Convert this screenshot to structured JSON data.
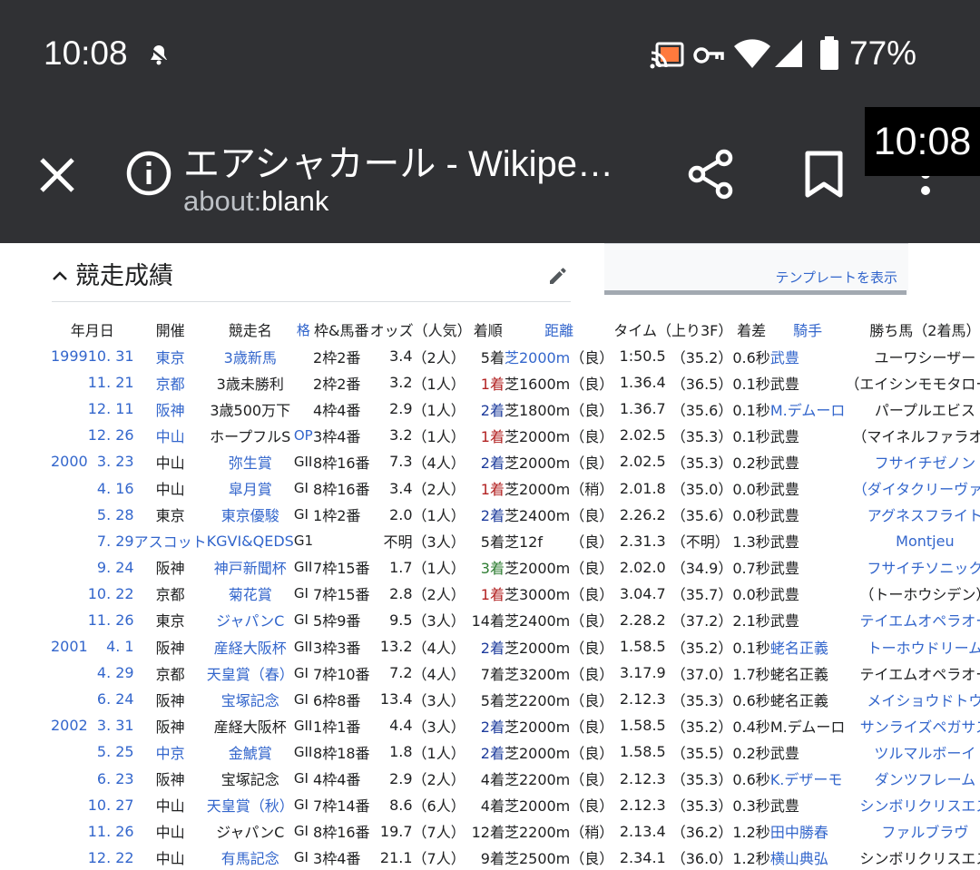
{
  "status_bar": {
    "time": "10:08",
    "battery": "77%",
    "icons": [
      "alert-icon",
      "cast-icon",
      "vpn-key-icon",
      "wifi-icon",
      "signal-icon",
      "battery-icon"
    ]
  },
  "toolbar": {
    "title": "エアシャカール - Wikipe…",
    "url_scheme": "about:",
    "url_host": "blank",
    "clock_overlay": "10:08"
  },
  "infobox": {
    "template_link": "テンプレートを表示"
  },
  "section": {
    "title": "競走成績"
  },
  "colors": {
    "link": "#3366cc",
    "win": "#b22222",
    "second": "#1e3c9c",
    "third": "#2e7d32",
    "toolbar": "#303134"
  },
  "table": {
    "headers": [
      "年月日",
      "開催",
      "競走名",
      "格",
      "枠&馬番",
      "オッズ（人気）",
      "着順",
      "距離",
      "タイム（上り3F）",
      "着差",
      "騎手",
      "勝ち馬（2着馬）"
    ],
    "rows": [
      {
        "yr": "1999",
        "md": "10. 31",
        "ven": "東京",
        "race": "3歳新馬",
        "grade": "",
        "gate": "2枠2番",
        "odds": "3.4",
        "pop": "（2人）",
        "fin": "5着",
        "dist": "芝2000m",
        "cond": "（良）",
        "time": "1:50.5",
        "last": "（35.2）",
        "margin": "0.6秒",
        "jockey": "武豊",
        "winner": "ユーワシーザー"
      },
      {
        "yr": "",
        "md": "11. 21",
        "ven": "京都",
        "race": "3歳未勝利",
        "grade": "",
        "gate": "2枠2番",
        "odds": "3.2",
        "pop": "（1人）",
        "fin": "1着",
        "dist": "芝1600m",
        "cond": "（良）",
        "time": "1.36.4",
        "last": "（36.5）",
        "margin": "0.1秒",
        "jockey": "武豊",
        "winner": "（エイシンモモタロー）"
      },
      {
        "yr": "",
        "md": "12. 11",
        "ven": "阪神",
        "race": "3歳500万下",
        "grade": "",
        "gate": "4枠4番",
        "odds": "2.9",
        "pop": "（1人）",
        "fin": "2着",
        "dist": "芝1800m",
        "cond": "（良）",
        "time": "1.36.7",
        "last": "（35.6）",
        "margin": "0.1秒",
        "jockey": "M.デムーロ",
        "winner": "パープルエビス"
      },
      {
        "yr": "",
        "md": "12. 26",
        "ven": "中山",
        "race": "ホープフルS",
        "grade": "OP",
        "gate": "3枠4番",
        "odds": "3.2",
        "pop": "（1人）",
        "fin": "1着",
        "dist": "芝2000m",
        "cond": "（良）",
        "time": "2.02.5",
        "last": "（35.3）",
        "margin": "0.1秒",
        "jockey": "武豊",
        "winner": "（マイネルファラオ）"
      },
      {
        "yr": "2000",
        "md": "3. 23",
        "ven": "中山",
        "race": "弥生賞",
        "grade": "GII",
        "gate": "8枠16番",
        "odds": "7.3",
        "pop": "（4人）",
        "fin": "2着",
        "dist": "芝2000m",
        "cond": "（良）",
        "time": "2.02.5",
        "last": "（35.3）",
        "margin": "0.2秒",
        "jockey": "武豊",
        "winner": "フサイチゼノン"
      },
      {
        "yr": "",
        "md": "4. 16",
        "ven": "中山",
        "race": "皐月賞",
        "grade": "GI",
        "gate": "8枠16番",
        "odds": "3.4",
        "pop": "（2人）",
        "fin": "1着",
        "dist": "芝2000m",
        "cond": "（稍）",
        "time": "2.01.8",
        "last": "（35.0）",
        "margin": "0.0秒",
        "jockey": "武豊",
        "winner": "（ダイタクリーヴァ）"
      },
      {
        "yr": "",
        "md": "5. 28",
        "ven": "東京",
        "race": "東京優駿",
        "grade": "GI",
        "gate": "1枠2番",
        "odds": "2.0",
        "pop": "（1人）",
        "fin": "2着",
        "dist": "芝2400m",
        "cond": "（良）",
        "time": "2.26.2",
        "last": "（35.6）",
        "margin": "0.0秒",
        "jockey": "武豊",
        "winner": "アグネスフライト"
      },
      {
        "yr": "",
        "md": "7. 29",
        "ven": "アスコット",
        "race": "KGVI&QEDS",
        "grade": "G1",
        "gate": "",
        "odds": "不明",
        "pop": "（3人）",
        "fin": "5着",
        "dist": "芝12f",
        "cond": "（良）",
        "time": "2.31.3",
        "last": "（不明）",
        "margin": "1.3秒",
        "jockey": "武豊",
        "winner": "Montjeu"
      },
      {
        "yr": "",
        "md": "9. 24",
        "ven": "阪神",
        "race": "神戸新聞杯",
        "grade": "GII",
        "gate": "7枠15番",
        "odds": "1.7",
        "pop": "（1人）",
        "fin": "3着",
        "dist": "芝2000m",
        "cond": "（良）",
        "time": "2.02.0",
        "last": "（34.9）",
        "margin": "0.7秒",
        "jockey": "武豊",
        "winner": "フサイチソニック"
      },
      {
        "yr": "",
        "md": "10. 22",
        "ven": "京都",
        "race": "菊花賞",
        "grade": "GI",
        "gate": "7枠15番",
        "odds": "2.8",
        "pop": "（2人）",
        "fin": "1着",
        "dist": "芝3000m",
        "cond": "（良）",
        "time": "3.04.7",
        "last": "（35.7）",
        "margin": "0.0秒",
        "jockey": "武豊",
        "winner": "（トーホウシデン）"
      },
      {
        "yr": "",
        "md": "11. 26",
        "ven": "東京",
        "race": "ジャパンC",
        "grade": "GI",
        "gate": "5枠9番",
        "odds": "9.5",
        "pop": "（3人）",
        "fin": "14着",
        "dist": "芝2400m",
        "cond": "（良）",
        "time": "2.28.2",
        "last": "（37.2）",
        "margin": "2.1秒",
        "jockey": "武豊",
        "winner": "テイエムオペラオー"
      },
      {
        "yr": "2001",
        "md": "4. 1",
        "ven": "阪神",
        "race": "産経大阪杯",
        "grade": "GII",
        "gate": "3枠3番",
        "odds": "13.2",
        "pop": "（4人）",
        "fin": "2着",
        "dist": "芝2000m",
        "cond": "（良）",
        "time": "1.58.5",
        "last": "（35.2）",
        "margin": "0.1秒",
        "jockey": "蛯名正義",
        "winner": "トーホウドリーム"
      },
      {
        "yr": "",
        "md": "4. 29",
        "ven": "京都",
        "race": "天皇賞（春）",
        "grade": "GI",
        "gate": "7枠10番",
        "odds": "7.2",
        "pop": "（4人）",
        "fin": "7着",
        "dist": "芝3200m",
        "cond": "（良）",
        "time": "3.17.9",
        "last": "（37.0）",
        "margin": "1.7秒",
        "jockey": "蛯名正義",
        "winner": "テイエムオペラオー"
      },
      {
        "yr": "",
        "md": "6. 24",
        "ven": "阪神",
        "race": "宝塚記念",
        "grade": "GI",
        "gate": "6枠8番",
        "odds": "13.4",
        "pop": "（3人）",
        "fin": "5着",
        "dist": "芝2200m",
        "cond": "（良）",
        "time": "2.12.3",
        "last": "（35.3）",
        "margin": "0.6秒",
        "jockey": "蛯名正義",
        "winner": "メイショウドトウ"
      },
      {
        "yr": "2002",
        "md": "3. 31",
        "ven": "阪神",
        "race": "産経大阪杯",
        "grade": "GII",
        "gate": "1枠1番",
        "odds": "4.4",
        "pop": "（3人）",
        "fin": "2着",
        "dist": "芝2000m",
        "cond": "（良）",
        "time": "1.58.5",
        "last": "（35.2）",
        "margin": "0.4秒",
        "jockey": "M.デムーロ",
        "winner": "サンライズペガサス"
      },
      {
        "yr": "",
        "md": "5. 25",
        "ven": "中京",
        "race": "金鯱賞",
        "grade": "GII",
        "gate": "8枠18番",
        "odds": "1.8",
        "pop": "（1人）",
        "fin": "2着",
        "dist": "芝2000m",
        "cond": "（良）",
        "time": "1.58.5",
        "last": "（35.5）",
        "margin": "0.2秒",
        "jockey": "武豊",
        "winner": "ツルマルボーイ"
      },
      {
        "yr": "",
        "md": "6. 23",
        "ven": "阪神",
        "race": "宝塚記念",
        "grade": "GI",
        "gate": "4枠4番",
        "odds": "2.9",
        "pop": "（2人）",
        "fin": "4着",
        "dist": "芝2200m",
        "cond": "（良）",
        "time": "2.12.3",
        "last": "（35.3）",
        "margin": "0.6秒",
        "jockey": "K.デザーモ",
        "winner": "ダンツフレーム"
      },
      {
        "yr": "",
        "md": "10. 27",
        "ven": "中山",
        "race": "天皇賞（秋）",
        "grade": "GI",
        "gate": "7枠14番",
        "odds": "8.6",
        "pop": "（6人）",
        "fin": "4着",
        "dist": "芝2000m",
        "cond": "（良）",
        "time": "2.12.3",
        "last": "（35.3）",
        "margin": "0.3秒",
        "jockey": "武豊",
        "winner": "シンボリクリスエス"
      },
      {
        "yr": "",
        "md": "11. 26",
        "ven": "中山",
        "race": "ジャパンC",
        "grade": "GI",
        "gate": "8枠16番",
        "odds": "19.7",
        "pop": "（7人）",
        "fin": "12着",
        "dist": "芝2200m",
        "cond": "（稍）",
        "time": "2.13.4",
        "last": "（36.2）",
        "margin": "1.2秒",
        "jockey": "田中勝春",
        "winner": "ファルブラヴ"
      },
      {
        "yr": "",
        "md": "12. 22",
        "ven": "中山",
        "race": "有馬記念",
        "grade": "GI",
        "gate": "3枠4番",
        "odds": "21.1",
        "pop": "（7人）",
        "fin": "9着",
        "dist": "芝2500m",
        "cond": "（良）",
        "time": "2.34.1",
        "last": "（36.0）",
        "margin": "1.2秒",
        "jockey": "横山典弘",
        "winner": "シンボリクリスエス"
      }
    ]
  }
}
